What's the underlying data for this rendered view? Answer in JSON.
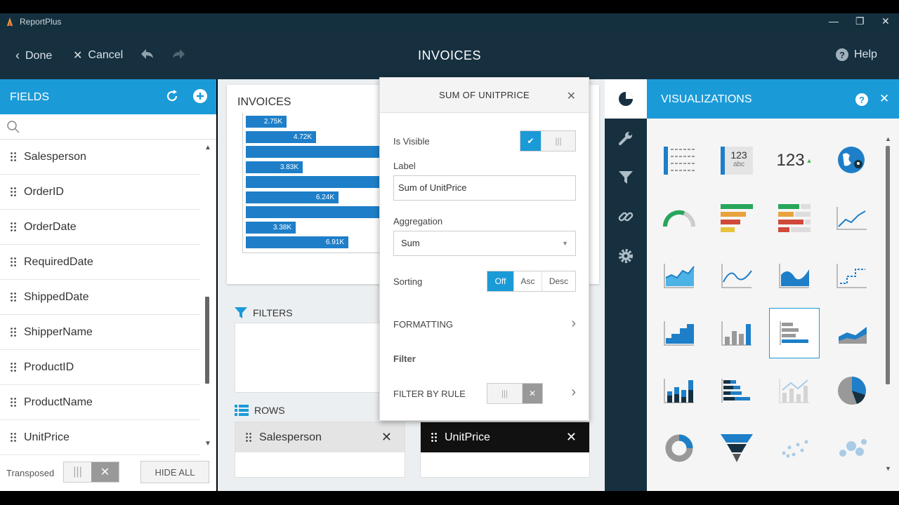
{
  "app": {
    "name": "ReportPlus"
  },
  "topbar": {
    "done": "Done",
    "cancel": "Cancel",
    "title": "INVOICES",
    "help": "Help"
  },
  "fields": {
    "title": "FIELDS",
    "items": [
      "Salesperson",
      "OrderID",
      "OrderDate",
      "RequiredDate",
      "ShippedDate",
      "ShipperName",
      "ProductID",
      "ProductName",
      "UnitPrice"
    ],
    "transposed_label": "Transposed",
    "hide_all": "HIDE ALL"
  },
  "chart": {
    "title": "INVOICES",
    "bars": [
      {
        "label": "2.75K",
        "value": 2.75
      },
      {
        "label": "4.72K",
        "value": 4.72
      },
      {
        "label": "",
        "value": 9.0
      },
      {
        "label": "3.83K",
        "value": 3.83
      },
      {
        "label": "",
        "value": 9.0
      },
      {
        "label": "6.24K",
        "value": 6.24
      },
      {
        "label": "",
        "value": 9.0
      },
      {
        "label": "3.38K",
        "value": 3.38
      },
      {
        "label": "6.91K",
        "value": 6.91
      }
    ]
  },
  "filters": {
    "title": "FILTERS"
  },
  "rows": {
    "title": "ROWS",
    "salesperson": "Salesperson",
    "unitprice": "UnitPrice"
  },
  "popup": {
    "title": "SUM OF UNITPRICE",
    "is_visible": "Is Visible",
    "label_title": "Label",
    "label_value": "Sum of UnitPrice",
    "aggregation_title": "Aggregation",
    "aggregation_value": "Sum",
    "sorting": "Sorting",
    "sort_off": "Off",
    "sort_asc": "Asc",
    "sort_desc": "Desc",
    "formatting": "FORMATTING",
    "filter": "Filter",
    "filter_by_rule": "FILTER BY RULE"
  },
  "viz": {
    "title": "VISUALIZATIONS",
    "kpi1": "123",
    "kpi1_sub": "abc",
    "kpi2": "123"
  },
  "colors": {
    "accent": "#1b9ad8",
    "dark": "#163040",
    "bar": "#1e7fc8"
  }
}
